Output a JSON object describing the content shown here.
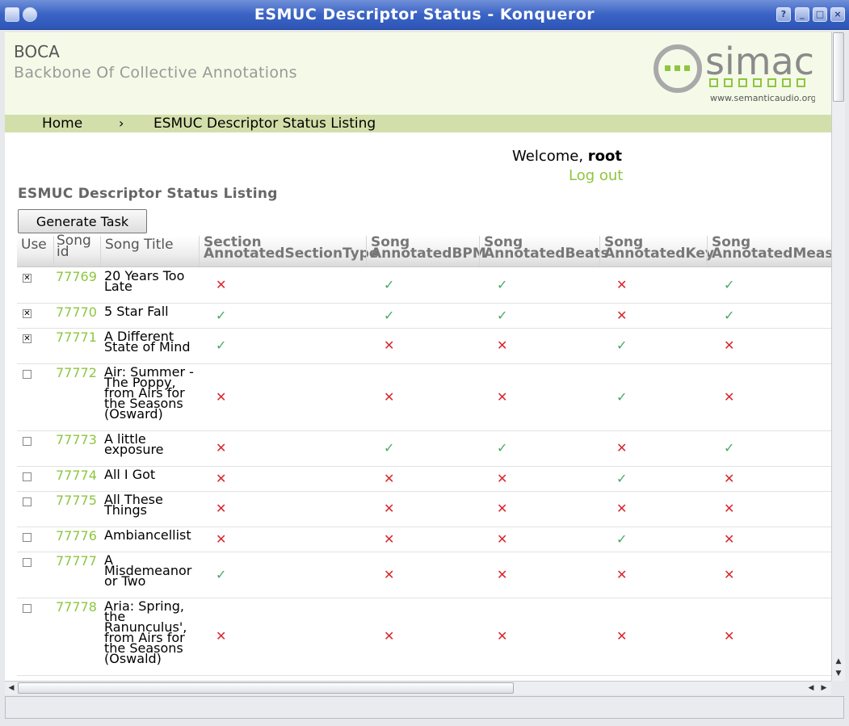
{
  "window": {
    "title": "ESMUC Descriptor Status - Konqueror"
  },
  "header": {
    "site_name": "BOCA",
    "site_subtitle": "Backbone Of Collective Annotations",
    "logo_text": "simac",
    "logo_url_text": "www.semanticaudio.org"
  },
  "nav": {
    "home": "Home",
    "separator": "›",
    "current": "ESMUC Descriptor Status Listing"
  },
  "user": {
    "welcome": "Welcome,",
    "name": "root",
    "logout": "Log out"
  },
  "page": {
    "heading": "ESMUC Descriptor Status Listing",
    "generate_button": "Generate Task"
  },
  "table": {
    "columns": [
      {
        "line1": "Use",
        "line2": ""
      },
      {
        "line1": "Song",
        "line2": "id"
      },
      {
        "line1": "Song Title",
        "line2": ""
      },
      {
        "line1": "Section",
        "line2": "AnnotatedSectionType"
      },
      {
        "line1": "Song",
        "line2": "AnnotatedBPM"
      },
      {
        "line1": "Song",
        "line2": "AnnotatedBeats"
      },
      {
        "line1": "Song",
        "line2": "AnnotatedKey"
      },
      {
        "line1": "Song",
        "line2": "AnnotatedMeasur"
      }
    ],
    "rows": [
      {
        "checked": true,
        "id": "77769",
        "title": "20 Years Too Late",
        "marks": [
          false,
          true,
          true,
          false,
          true
        ]
      },
      {
        "checked": true,
        "id": "77770",
        "title": "5 Star Fall",
        "marks": [
          true,
          true,
          true,
          false,
          true
        ]
      },
      {
        "checked": true,
        "id": "77771",
        "title": "A Different State of Mind",
        "marks": [
          true,
          false,
          false,
          true,
          false
        ]
      },
      {
        "checked": false,
        "id": "77772",
        "title": "Air: Summer - The Poppy, from Airs for the Seasons (Osward)",
        "marks": [
          false,
          false,
          false,
          true,
          false
        ]
      },
      {
        "checked": false,
        "id": "77773",
        "title": "A little exposure",
        "marks": [
          false,
          true,
          true,
          false,
          true
        ]
      },
      {
        "checked": false,
        "id": "77774",
        "title": "All I Got",
        "marks": [
          false,
          false,
          false,
          true,
          false
        ]
      },
      {
        "checked": false,
        "id": "77775",
        "title": "All These Things",
        "marks": [
          false,
          false,
          false,
          false,
          false
        ]
      },
      {
        "checked": false,
        "id": "77776",
        "title": "Ambiancellist",
        "marks": [
          false,
          false,
          false,
          true,
          false
        ]
      },
      {
        "checked": false,
        "id": "77777",
        "title": "A Misdemeanor or Two",
        "marks": [
          true,
          false,
          false,
          false,
          false
        ]
      },
      {
        "checked": false,
        "id": "77778",
        "title": "Aria: Spring, the Ranunculus', from Airs for the Seasons (Oswald)",
        "marks": [
          false,
          false,
          false,
          false,
          false
        ]
      }
    ]
  },
  "glyphs": {
    "yes": "✓",
    "no": "✕",
    "checkbox_on": "✕",
    "scroll_up": "▲",
    "scroll_down": "▼",
    "scroll_left": "◀",
    "scroll_right": "▶"
  },
  "icons": [
    "konqueror-app-icon",
    "window-menu-icon",
    "help-icon",
    "minimize-icon",
    "maximize-icon",
    "close-icon"
  ],
  "colors": {
    "accent_green": "#8dc63f",
    "check_green": "#4aa868",
    "cross_red": "#d8262e",
    "nav_bg": "#d3dfaa",
    "header_bg": "#f5fae8",
    "titlebar_blue": "#3a63c4"
  }
}
